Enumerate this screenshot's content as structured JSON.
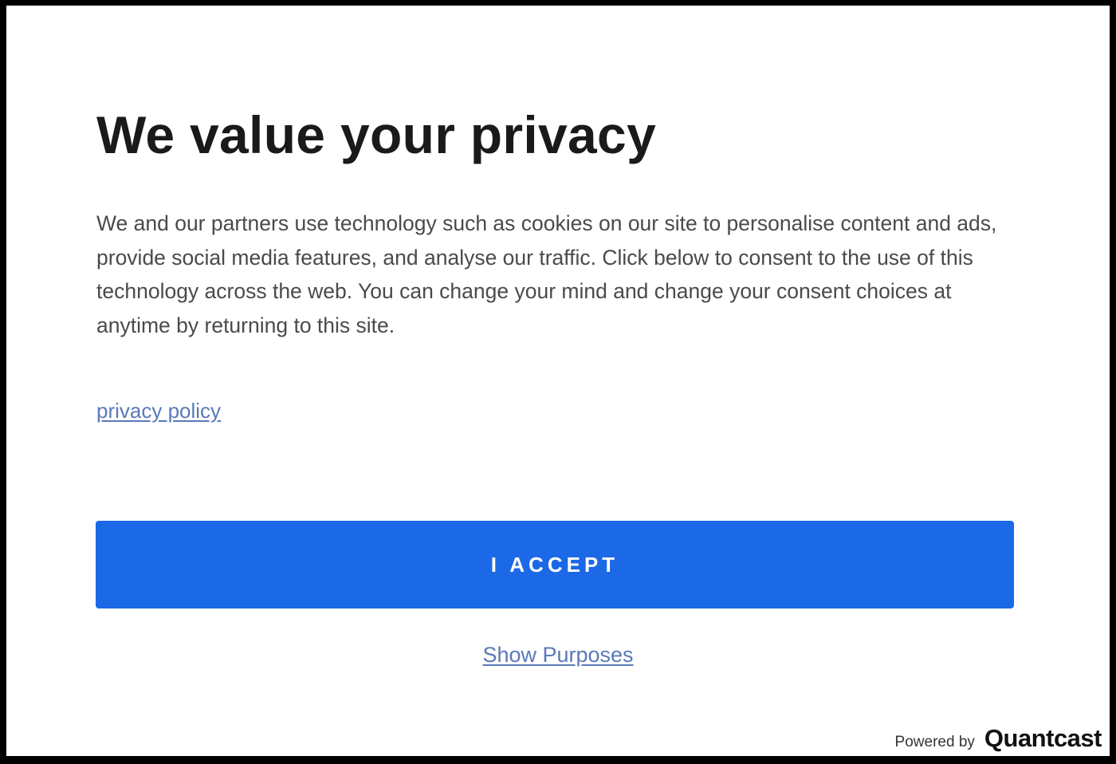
{
  "dialog": {
    "title": "We value your privacy",
    "body": "We and our partners use technology such as cookies on our site to personalise content and ads, provide social media features, and analyse our traffic. Click below to consent to the use of this technology across the web. You can change your mind and change your consent choices at anytime by returning to this site.",
    "privacy_link": "privacy policy",
    "accept_label": "I ACCEPT",
    "purposes_link": "Show Purposes"
  },
  "footer": {
    "powered_by": "Powered by",
    "brand": "Quantcast"
  },
  "colors": {
    "accent": "#1c69e8",
    "link": "#5a79b8",
    "title": "#1a1a1a",
    "body_text": "#4a4a4a"
  }
}
